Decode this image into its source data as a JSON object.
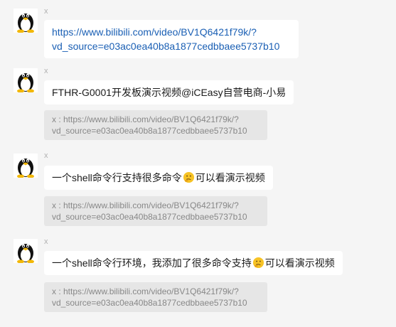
{
  "messages": [
    {
      "sender": "x",
      "text_lines": [
        "https://www.bilibili.com/video/BV1Q6421f79k/?",
        "vd_source=e03ac0ea40b8a1877cedbbaee5737b10"
      ]
    },
    {
      "sender": "x",
      "text": "FTHR-G0001开发板演示视频@iCEasy自营电商-小易",
      "quote_lines": [
        "x : https://www.bilibili.com/video/BV1Q6421f79k/?",
        "vd_source=e03ac0ea40b8a1877cedbbaee5737b10"
      ]
    },
    {
      "sender": "x",
      "text_before_emoji": "一个shell命令行支持很多命令",
      "emoji": "thinking-face-icon",
      "text_after_emoji": "可以看演示视频",
      "quote_lines": [
        "x : https://www.bilibili.com/video/BV1Q6421f79k/?",
        "vd_source=e03ac0ea40b8a1877cedbbaee5737b10"
      ]
    },
    {
      "sender": "x",
      "text_before_emoji": "一个shell命令行环境，我添加了很多命令支持",
      "emoji": "thinking-face-icon",
      "text_after_emoji": "可以看演示视频",
      "quote_lines": [
        "x : https://www.bilibili.com/video/BV1Q6421f79k/?",
        "vd_source=e03ac0ea40b8a1877cedbbaee5737b10"
      ]
    }
  ],
  "avatar_icon": "tux-penguin-icon",
  "colors": {
    "background": "#f5f5f5",
    "bubble": "#ffffff",
    "quote": "#e6e6e6",
    "link": "#1a5fb4",
    "emoji": "#f7c325"
  }
}
